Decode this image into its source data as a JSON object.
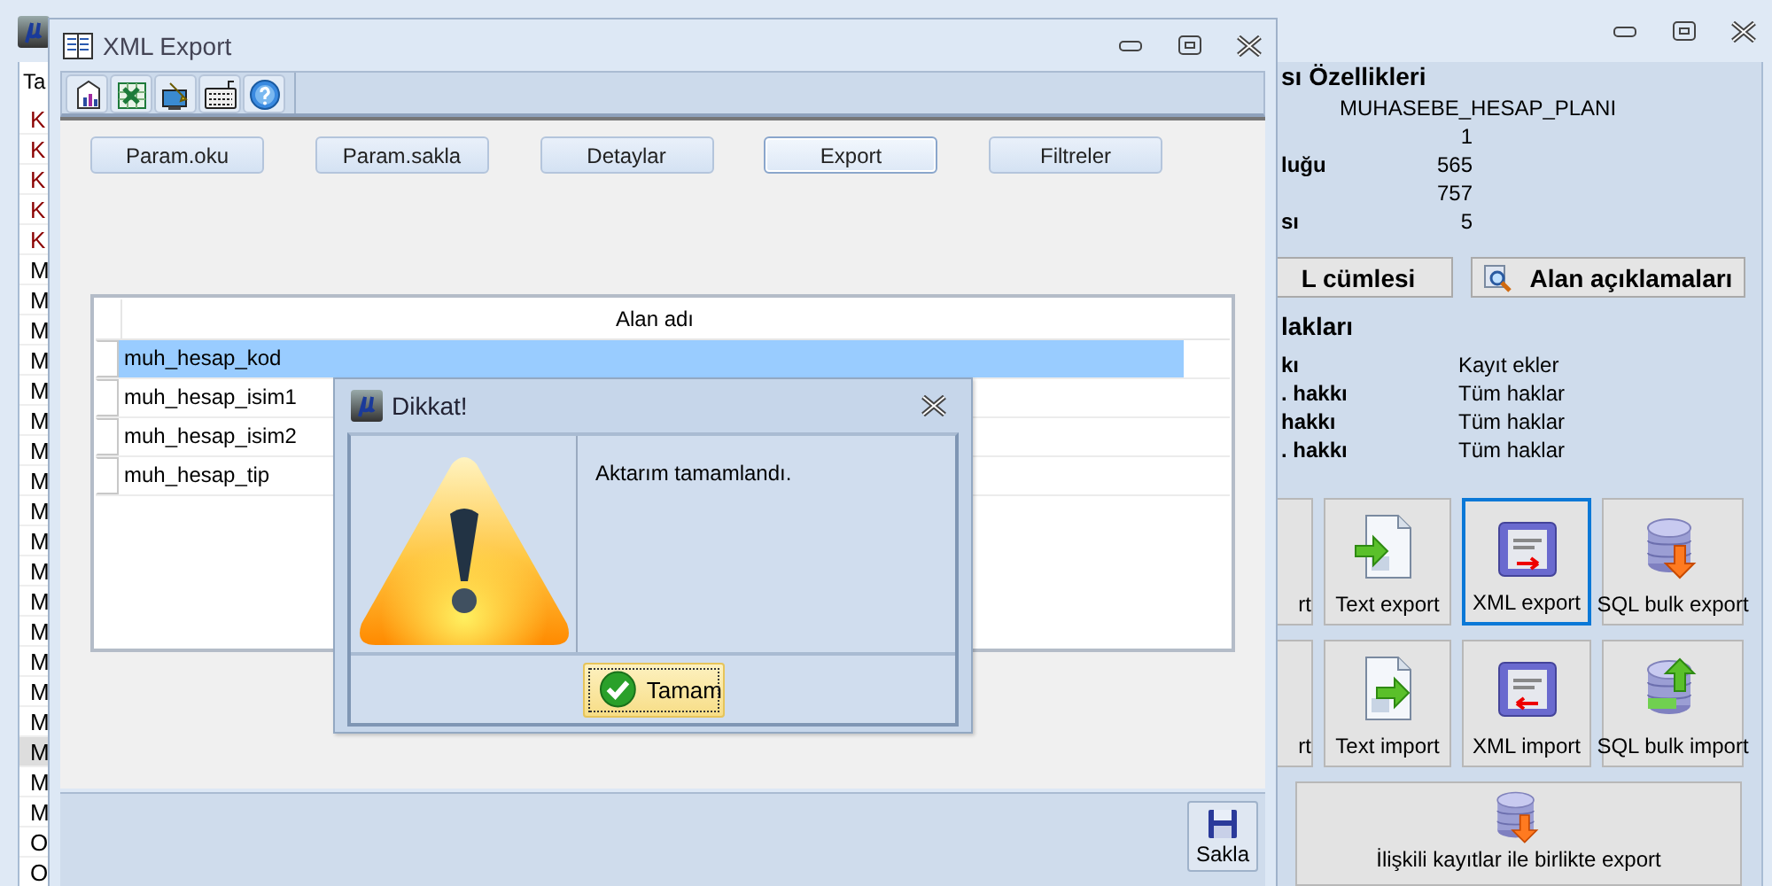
{
  "app_window": {
    "list": {
      "header": "Ta",
      "items": [
        {
          "text": "K",
          "color": "#8b0000",
          "selected": false
        },
        {
          "text": "K",
          "color": "#8b0000",
          "selected": false
        },
        {
          "text": "K",
          "color": "#8b0000",
          "selected": false
        },
        {
          "text": "K",
          "color": "#8b0000",
          "selected": false
        },
        {
          "text": "K",
          "color": "#8b0000",
          "selected": false
        },
        {
          "text": "M",
          "color": "#000000",
          "selected": false
        },
        {
          "text": "M",
          "color": "#000000",
          "selected": false
        },
        {
          "text": "M",
          "color": "#000000",
          "selected": false
        },
        {
          "text": "M",
          "color": "#000000",
          "selected": false
        },
        {
          "text": "M",
          "color": "#000000",
          "selected": false
        },
        {
          "text": "M",
          "color": "#000000",
          "selected": false
        },
        {
          "text": "M",
          "color": "#000000",
          "selected": false
        },
        {
          "text": "M",
          "color": "#000000",
          "selected": false
        },
        {
          "text": "M",
          "color": "#000000",
          "selected": false
        },
        {
          "text": "M",
          "color": "#000000",
          "selected": false
        },
        {
          "text": "M",
          "color": "#000000",
          "selected": false
        },
        {
          "text": "M",
          "color": "#000000",
          "selected": false
        },
        {
          "text": "M",
          "color": "#000000",
          "selected": false
        },
        {
          "text": "M",
          "color": "#000000",
          "selected": false
        },
        {
          "text": "M",
          "color": "#000000",
          "selected": false
        },
        {
          "text": "M",
          "color": "#000000",
          "selected": false
        },
        {
          "text": "M",
          "color": "#000000",
          "selected": true
        },
        {
          "text": "M",
          "color": "#000000",
          "selected": false
        },
        {
          "text": "M",
          "color": "#000000",
          "selected": false
        },
        {
          "text": "O",
          "color": "#000000",
          "selected": false
        },
        {
          "text": "O",
          "color": "#000000",
          "selected": false
        }
      ]
    },
    "properties_panel": {
      "title": "sı Özellikleri",
      "table_name": "MUHASEBE_HESAP_PLANI",
      "properties": [
        {
          "value": "1"
        },
        {
          "label": "luğu",
          "value": "565"
        },
        {
          "value": "757"
        },
        {
          "label": "sı",
          "value": "5"
        }
      ],
      "buttons": [
        {
          "kind": "plain",
          "label": "L cümlesi"
        },
        {
          "kind": "search",
          "label": "Alan açıklamaları"
        }
      ],
      "rights_title": "lakları",
      "rights": [
        {
          "label": "kı",
          "value": "Kayıt ekler"
        },
        {
          "label": ". hakkı",
          "value": "Tüm haklar"
        },
        {
          "label": "hakkı",
          "value": "Tüm haklar"
        },
        {
          "label": ". hakkı",
          "value": "Tüm haklar"
        }
      ],
      "tiles": [
        {
          "kind": "clipped",
          "label": "rt",
          "selected": false
        },
        {
          "kind": "text-export",
          "label": "Text export",
          "selected": false
        },
        {
          "kind": "xml-export",
          "label": "XML export",
          "selected": true
        },
        {
          "kind": "sql-export",
          "label": "SQL bulk export",
          "selected": false
        },
        {
          "kind": "clipped",
          "label": "rt",
          "selected": false
        },
        {
          "kind": "text-import",
          "label": "Text import",
          "selected": false
        },
        {
          "kind": "xml-import",
          "label": "XML import",
          "selected": false
        },
        {
          "kind": "sql-import",
          "label": "SQL bulk import",
          "selected": false
        }
      ],
      "wide_tile": {
        "kind": "db-export",
        "label": "İlişkili kayıtlar ile birlikte export"
      }
    }
  },
  "xml_window": {
    "title": "XML Export",
    "buttons": [
      {
        "label": "Param.oku",
        "focused": false
      },
      {
        "label": "Param.sakla",
        "focused": false
      },
      {
        "label": "Detaylar",
        "focused": false
      },
      {
        "label": "Export",
        "focused": true
      },
      {
        "label": "Filtreler",
        "focused": false
      }
    ],
    "grid": {
      "column": "Alan adı",
      "rows": [
        {
          "text": "muh_hesap_kod",
          "selected": true
        },
        {
          "text": "muh_hesap_isim1",
          "selected": false
        },
        {
          "text": "muh_hesap_isim2",
          "selected": false
        },
        {
          "text": "muh_hesap_tip",
          "selected": false
        }
      ]
    },
    "save_button": "Sakla"
  },
  "dialog": {
    "title": "Dikkat!",
    "message": "Aktarım tamamlandı.",
    "button": "Tamam"
  }
}
